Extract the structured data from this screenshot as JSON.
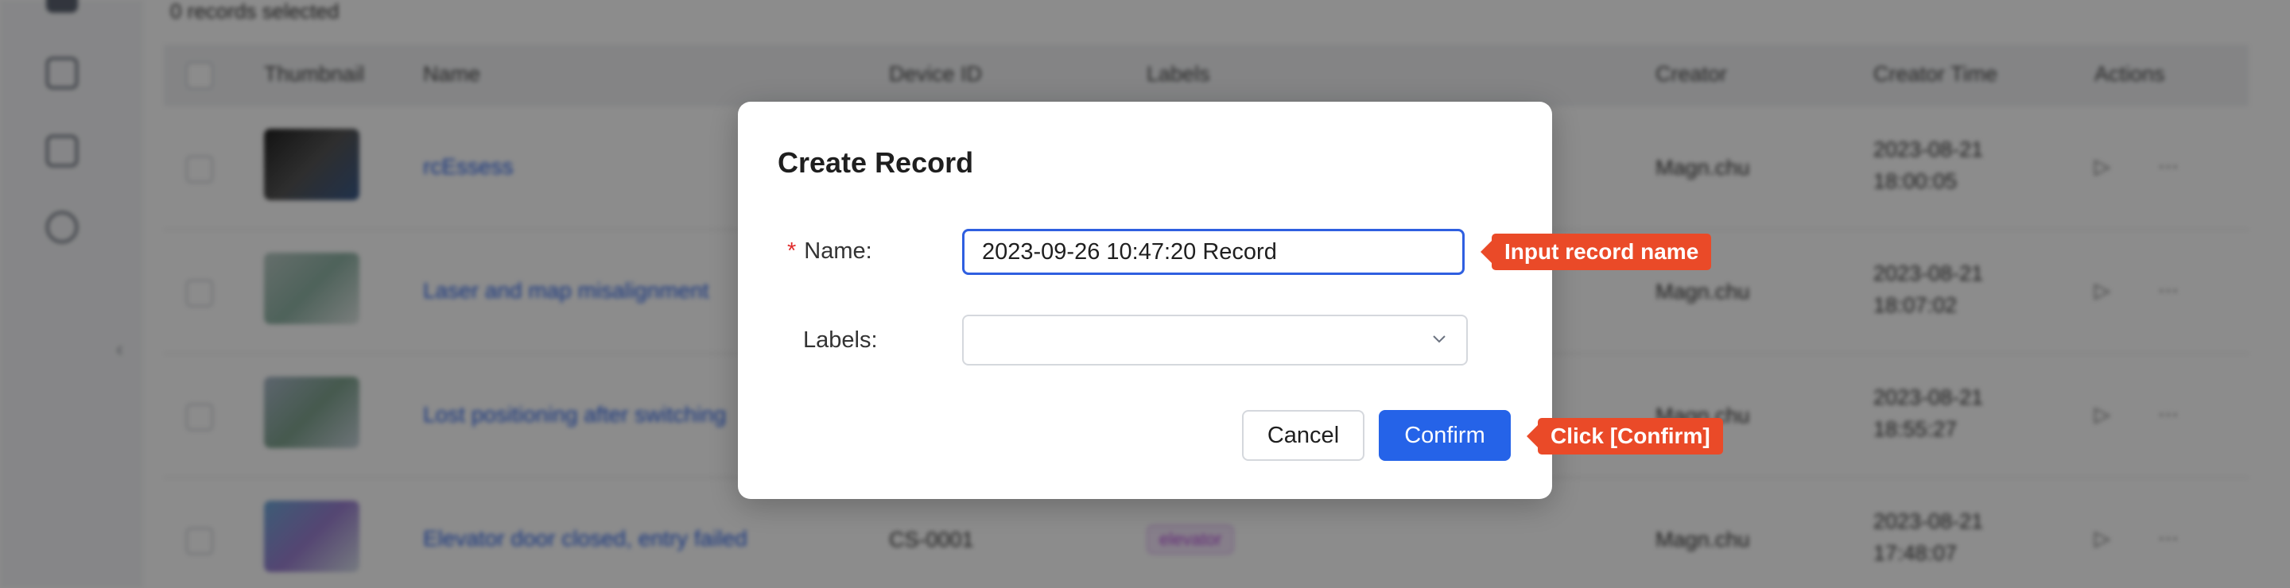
{
  "background": {
    "selected_text": "0 records selected",
    "columns": [
      "Thumbnail",
      "Name",
      "Device ID",
      "Labels",
      "Creator",
      "Creator Time",
      "Actions"
    ],
    "rows": [
      {
        "name": "rcEssess",
        "device_id": "",
        "label": "",
        "creator": "Magn.chu",
        "time": "2023-08-21 18:00:05"
      },
      {
        "name": "Laser and map misalignment",
        "device_id": "",
        "label": "",
        "creator": "Magn.chu",
        "time": "2023-08-21 18:07:02"
      },
      {
        "name": "Lost positioning after switching",
        "device_id": "",
        "label": "",
        "creator": "Magn.chu",
        "time": "2023-08-21 18:55:27"
      },
      {
        "name": "Elevator door closed, entry failed",
        "device_id": "CS-0001",
        "label": "elevator",
        "creator": "Magn.chu",
        "time": "2023-08-21 17:48:07"
      }
    ],
    "action_play": "▷",
    "action_more": "⋯"
  },
  "modal": {
    "title": "Create Record",
    "name_required_mark": "*",
    "name_label": "Name:",
    "name_value": "2023-09-26 10:47:20 Record",
    "labels_label": "Labels:",
    "labels_value": "",
    "cancel_label": "Cancel",
    "confirm_label": "Confirm"
  },
  "callouts": {
    "name_hint": "Input record name",
    "confirm_hint": "Click [Confirm]"
  },
  "colors": {
    "primary": "#2563e8",
    "callout": "#ea4a28",
    "required": "#e02c2c"
  },
  "icons": {
    "labels_dropdown": "chevron-down-icon"
  }
}
